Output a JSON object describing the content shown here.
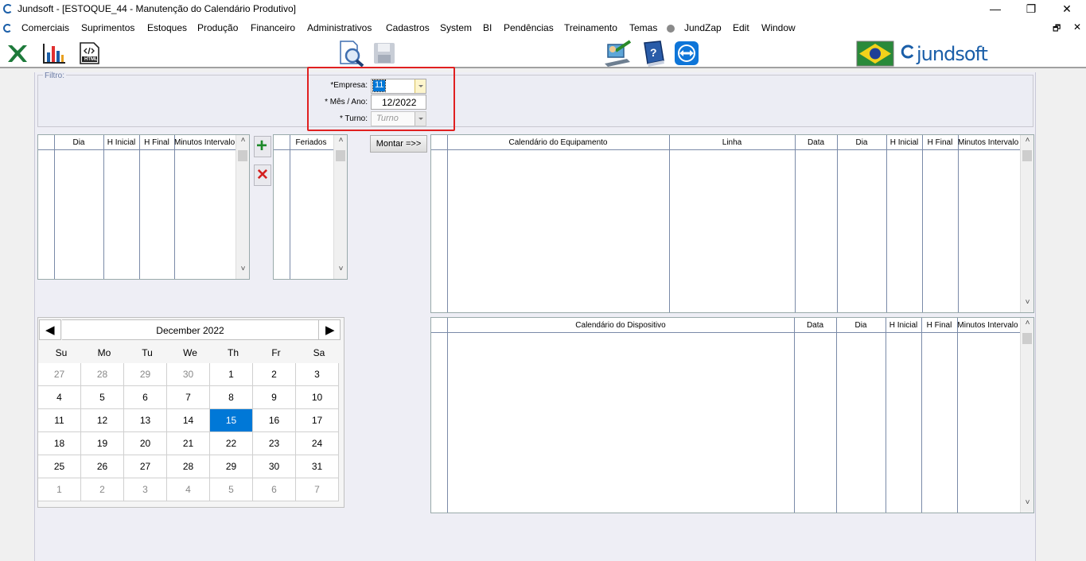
{
  "window": {
    "title": "Jundsoft - [ESTOQUE_44 - Manutenção do Calendário Produtivo]",
    "minimize": "—",
    "maximize": "❐",
    "close": "✕",
    "mdi_restore": "🗗",
    "mdi_close": "✕"
  },
  "menu": [
    "Comerciais",
    "Suprimentos",
    "Estoques",
    "Produção",
    "Financeiro",
    "Administrativos",
    "Cadastros",
    "System",
    "BI",
    "Pendências",
    "Treinamento",
    "Temas",
    "JundZap",
    "Edit",
    "Window"
  ],
  "toolbar": {
    "icons": [
      "excel-icon",
      "chart-icon",
      "html-icon",
      "search-document-icon",
      "save-disk-icon",
      "user-help-icon",
      "help-book-icon",
      "teamviewer-icon",
      "brazil-flag-icon"
    ],
    "html_label": "HTML",
    "logo_text": "jundsoft",
    "help_mark": "?"
  },
  "filter": {
    "legend": "Filtro:",
    "empresa_label": "*Empresa:",
    "empresa_value": "11",
    "mes_ano_label": "* Mês / Ano:",
    "mes_ano_value": "12/2022",
    "turno_label": "* Turno:",
    "turno_placeholder": "Turno"
  },
  "grid_turno": {
    "columns": [
      "Dia",
      "H Inicial",
      "H Final",
      "Minutos Intervalo"
    ]
  },
  "grid_feriados": {
    "columns": [
      "Feriados"
    ]
  },
  "buttons": {
    "add": "+",
    "remove": "✕",
    "montar": "Montar =>>"
  },
  "grid_equipamento": {
    "columns": [
      "Calendário do Equipamento",
      "Linha",
      "Data",
      "Dia",
      "H Inicial",
      "H Final",
      "Minutos Intervalo"
    ]
  },
  "grid_dispositivo": {
    "columns": [
      "Calendário do Dispositivo",
      "Data",
      "Dia",
      "H Inicial",
      "H Final",
      "Minutos Intervalo"
    ]
  },
  "scroll": {
    "up": "˄",
    "down": "˅"
  },
  "calendar": {
    "month_label": "December 2022",
    "prev": "◀",
    "next": "▶",
    "weekdays": [
      "Su",
      "Mo",
      "Tu",
      "We",
      "Th",
      "Fr",
      "Sa"
    ],
    "weeks": [
      [
        "27",
        "28",
        "29",
        "30",
        "1",
        "2",
        "3"
      ],
      [
        "4",
        "5",
        "6",
        "7",
        "8",
        "9",
        "10"
      ],
      [
        "11",
        "12",
        "13",
        "14",
        "15",
        "16",
        "17"
      ],
      [
        "18",
        "19",
        "20",
        "21",
        "22",
        "23",
        "24"
      ],
      [
        "25",
        "26",
        "27",
        "28",
        "29",
        "30",
        "31"
      ],
      [
        "1",
        "2",
        "3",
        "4",
        "5",
        "6",
        "7"
      ]
    ],
    "selected_day": "15"
  }
}
